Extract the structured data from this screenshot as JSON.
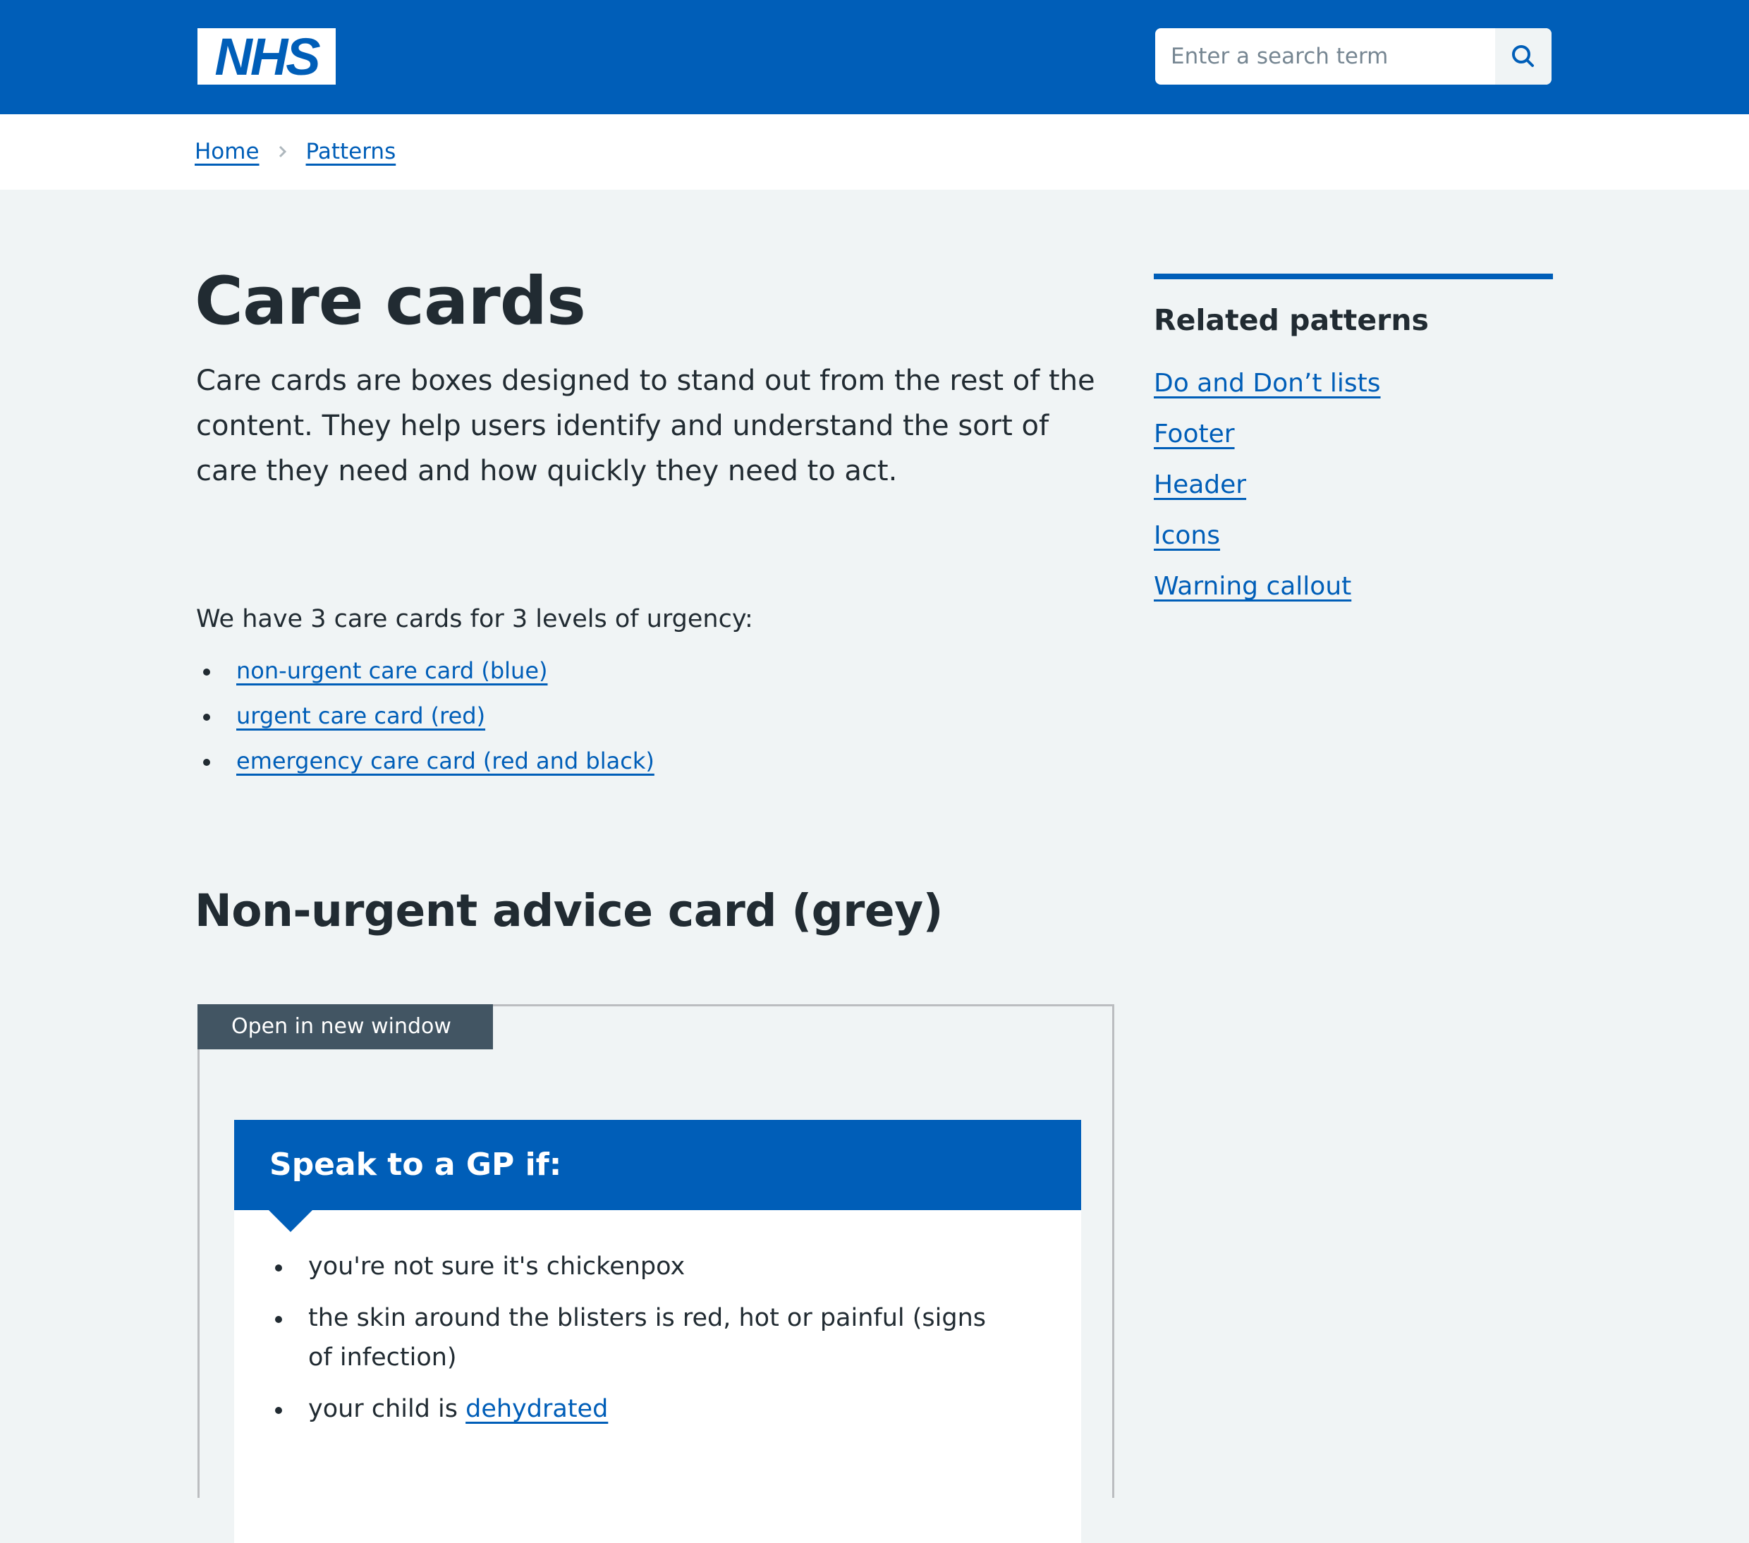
{
  "header": {
    "logo_text": "NHS",
    "search": {
      "placeholder": "Enter a search term",
      "value": "",
      "button_icon": "search-icon"
    }
  },
  "breadcrumb": {
    "items": [
      {
        "label": "Home"
      },
      {
        "label": "Patterns"
      }
    ],
    "separator_icon": "chevron-right-icon"
  },
  "main": {
    "title": "Care cards",
    "lede": "Care cards are boxes designed to stand out from the rest of the content. They help users identify and understand the sort of care they need and how quickly they need to act.",
    "intro": "We have 3 care cards for 3 levels of urgency:",
    "urgency_links": [
      {
        "label": "non-urgent care card (blue)"
      },
      {
        "label": "urgent care card (red)"
      },
      {
        "label": "emergency care card (red and black)"
      }
    ],
    "section_title": "Non-urgent advice card (grey)",
    "example": {
      "open_new_window_label": "Open in new window",
      "care_card": {
        "heading": "Speak to a GP if:",
        "items": [
          {
            "text": "you're not sure it's chickenpox"
          },
          {
            "text": "the skin around the blisters is red, hot or painful (signs of infection)"
          },
          {
            "text": "your child is ",
            "link": "dehydrated"
          }
        ]
      }
    }
  },
  "sidebar": {
    "title": "Related patterns",
    "links": [
      {
        "label": "Do and Don’t lists"
      },
      {
        "label": "Footer"
      },
      {
        "label": "Header"
      },
      {
        "label": "Icons"
      },
      {
        "label": "Warning callout"
      }
    ]
  },
  "colors": {
    "nhs_blue": "#005eb8",
    "text": "#212b32",
    "page_background": "#f0f4f5",
    "tab_background": "#425563",
    "placeholder": "#768692"
  }
}
